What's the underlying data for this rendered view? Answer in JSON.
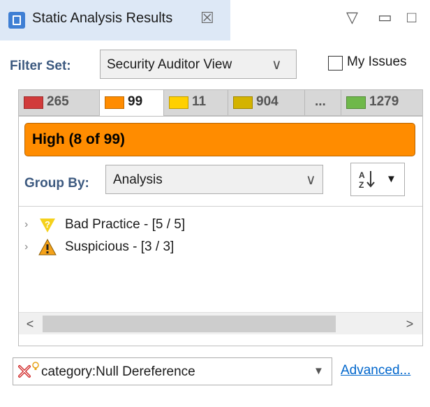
{
  "view": {
    "title": "Static Analysis Results",
    "close_glyph": "☒",
    "controls": [
      "▽",
      "▭",
      "□"
    ]
  },
  "filter": {
    "label": "Filter Set:",
    "selected": "Security Auditor View",
    "my_issues_label": "My Issues",
    "my_issues_checked": false
  },
  "priority_tabs": [
    {
      "count": "265",
      "color": "#d13b3b",
      "active": false
    },
    {
      "count": "99",
      "color": "#ff8c00",
      "active": true
    },
    {
      "count": "11",
      "color": "#ffd000",
      "active": false
    },
    {
      "count": "904",
      "color": "#d4b300",
      "active": false
    },
    {
      "count": "...",
      "active": false
    },
    {
      "count": "1279",
      "color": "#6fb84a",
      "active": false
    }
  ],
  "header": {
    "text": "High (8 of 99)",
    "color": "#ff8c00"
  },
  "group_by": {
    "label": "Group By:",
    "selected": "Analysis"
  },
  "sort_icon": "sort-alpha-icon",
  "tree": [
    {
      "label": "Bad Practice - [5 / 5]",
      "icon": "bad-practice-icon"
    },
    {
      "label": "Suspicious - [3 / 3]",
      "icon": "warning-triangle-icon"
    }
  ],
  "search": {
    "value": "category:Null Dereference",
    "advanced_label": "Advanced..."
  }
}
